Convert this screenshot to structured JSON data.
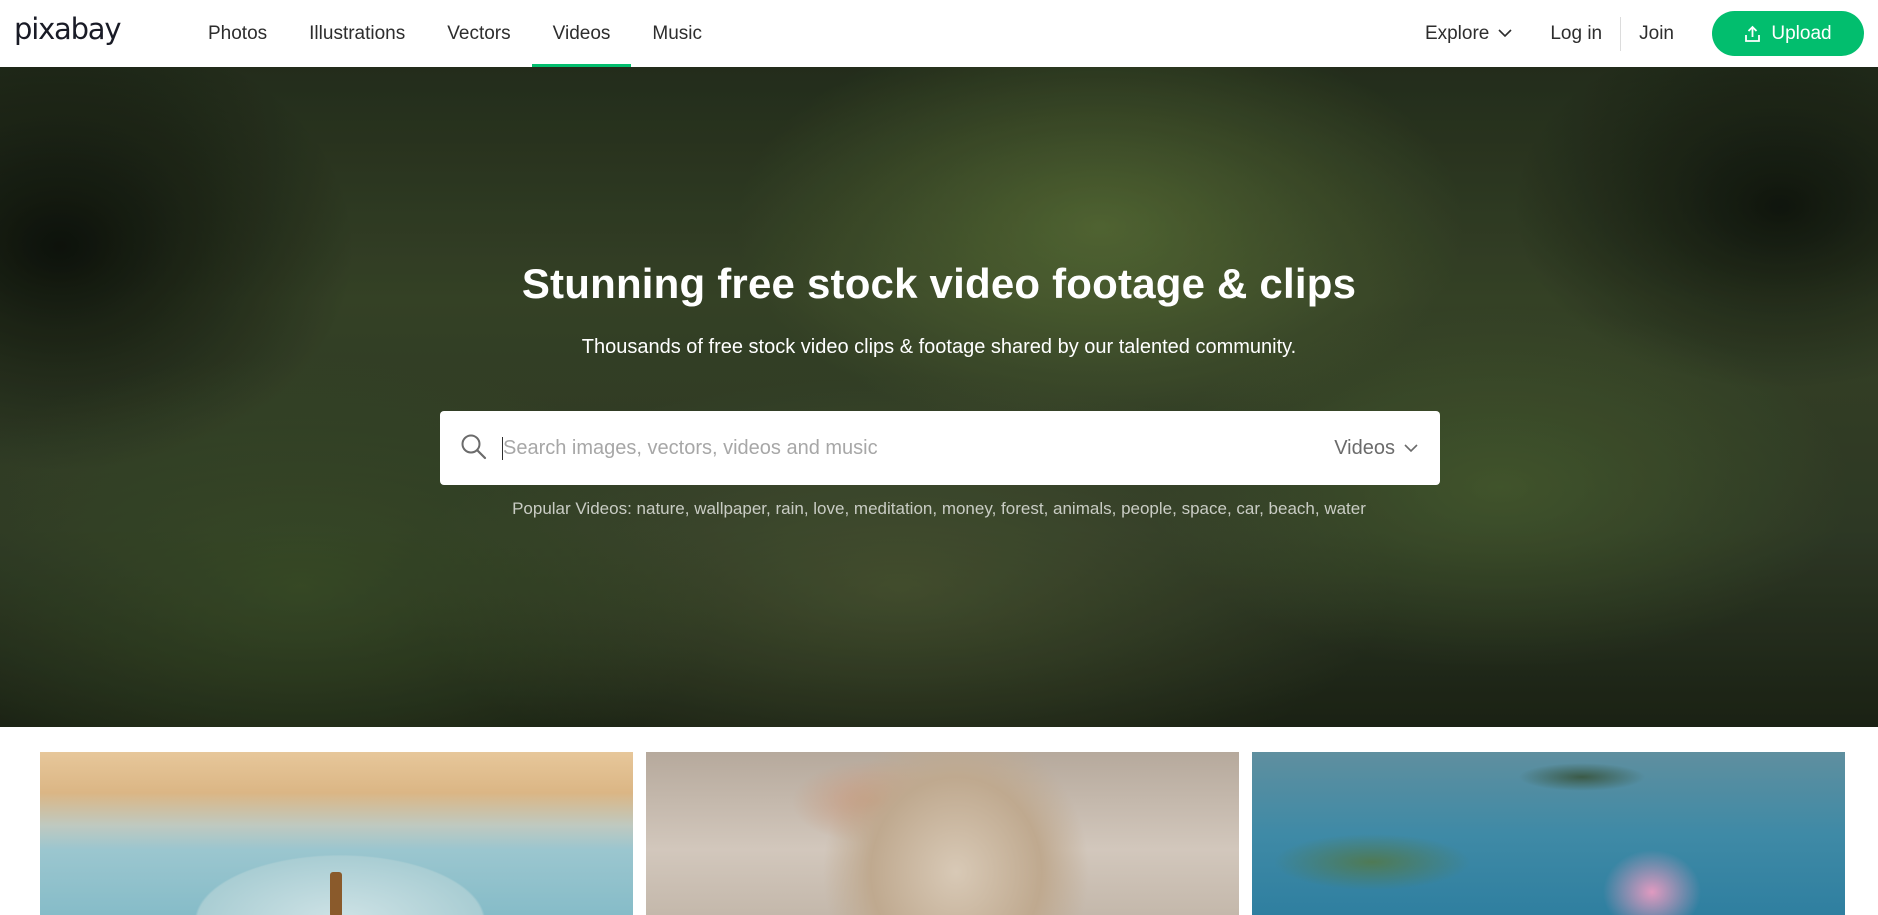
{
  "header": {
    "logo_text": "pixabay",
    "nav": [
      {
        "label": "Photos",
        "active": false
      },
      {
        "label": "Illustrations",
        "active": false
      },
      {
        "label": "Vectors",
        "active": false
      },
      {
        "label": "Videos",
        "active": true
      },
      {
        "label": "Music",
        "active": false
      }
    ],
    "explore_label": "Explore",
    "login_label": "Log in",
    "join_label": "Join",
    "upload_label": "Upload"
  },
  "hero": {
    "title": "Stunning free stock video footage & clips",
    "subtitle": "Thousands of free stock video clips & footage shared by our talented community.",
    "search": {
      "value": "",
      "placeholder": "Search images, vectors, videos and music",
      "type_label": "Videos"
    },
    "popular_label": "Popular Videos:",
    "popular_tags": [
      "nature",
      "wallpaper",
      "rain",
      "love",
      "meditation",
      "money",
      "forest",
      "animals",
      "people",
      "space",
      "car",
      "beach",
      "water"
    ]
  },
  "colors": {
    "accent": "#02be6e",
    "text": "#2d2d2d"
  },
  "icons": {
    "search": "search-icon",
    "chevron": "chevron-down-icon",
    "upload": "upload-icon"
  }
}
